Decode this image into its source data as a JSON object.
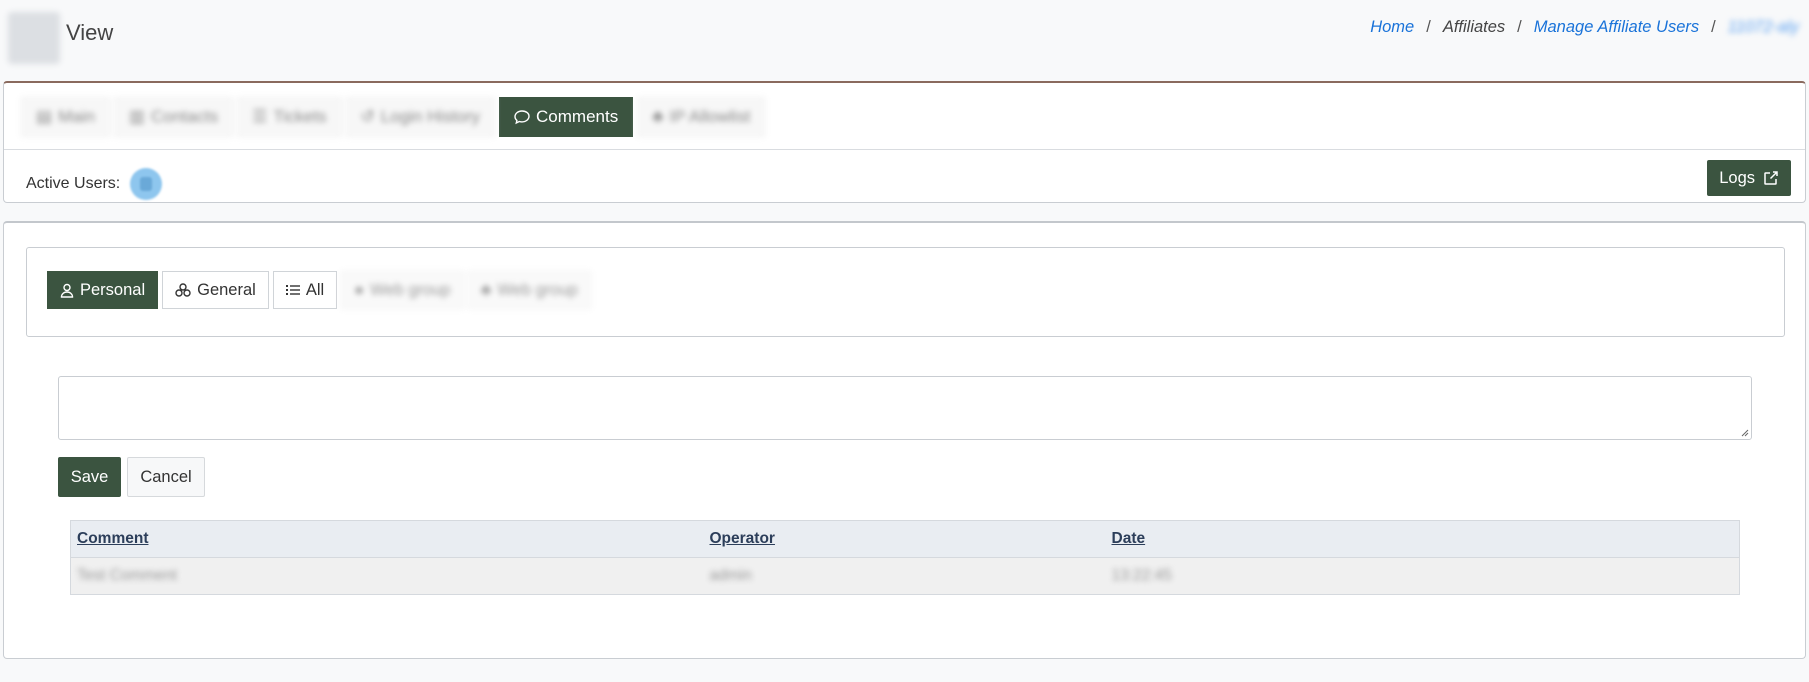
{
  "header": {
    "title": "View",
    "breadcrumb": {
      "home": "Home",
      "affiliates": "Affiliates",
      "manage": "Manage Affiliate Users",
      "current": "11072-aly"
    }
  },
  "tabs": [
    {
      "label": "Main",
      "icon": "id-card-icon"
    },
    {
      "label": "Contacts",
      "icon": "address-book-icon"
    },
    {
      "label": "Tickets",
      "icon": "ticket-icon"
    },
    {
      "label": "Login History",
      "icon": "history-icon"
    },
    {
      "label": "Comments",
      "icon": "chat-bubble-icon"
    },
    {
      "label": "IP Allowlist",
      "icon": "network-icon"
    }
  ],
  "active_users": {
    "label": "Active Users:"
  },
  "logs_button": {
    "label": "Logs",
    "icon": "external-link-icon"
  },
  "filters": [
    {
      "label": "Personal",
      "icon": "user-icon"
    },
    {
      "label": "General",
      "icon": "users-group-icon"
    },
    {
      "label": "All",
      "icon": "list-icon"
    },
    {
      "label": "Web group",
      "icon": "globe-icon"
    },
    {
      "label": "Web group",
      "icon": "sitemap-icon"
    }
  ],
  "form": {
    "comment_value": "",
    "save_label": "Save",
    "cancel_label": "Cancel"
  },
  "table": {
    "columns": [
      "Comment",
      "Operator",
      "Date"
    ],
    "rows": [
      [
        "Test Comment",
        "admin",
        "13:22:45"
      ]
    ]
  },
  "colors": {
    "primary_green": "#3b5440",
    "link_blue": "#1a73d9",
    "top_border_brown": "#8a6a5e"
  }
}
